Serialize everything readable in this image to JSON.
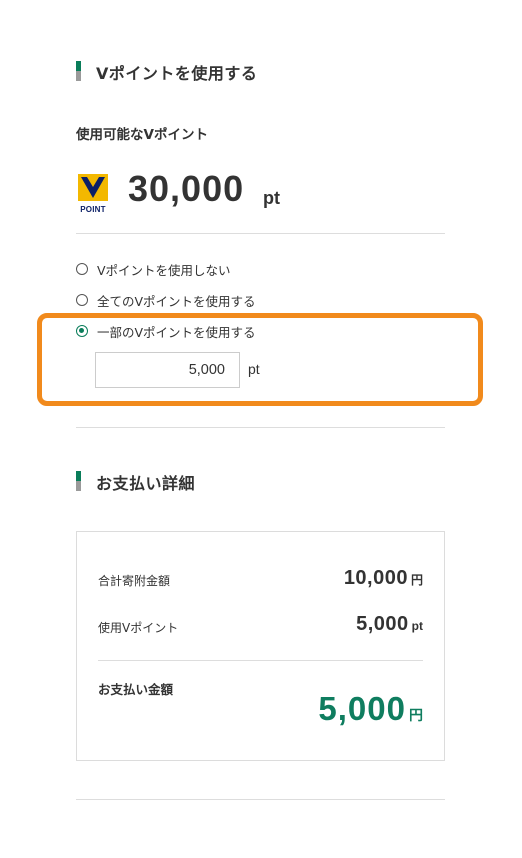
{
  "vpoint_section": {
    "title": "Vポイントを使用する",
    "available_label": "使用可能なVポイント",
    "logo_text": "POINT",
    "balance": "30,000",
    "balance_unit": "pt",
    "options": [
      {
        "label": "Vポイントを使用しない",
        "checked": false
      },
      {
        "label": "全てのVポイントを使用する",
        "checked": false
      },
      {
        "label": "一部のVポイントを使用する",
        "checked": true
      }
    ],
    "partial_input_value": "5,000",
    "partial_input_unit": "pt"
  },
  "payment_section": {
    "title": "お支払い詳細",
    "rows": [
      {
        "label": "合計寄附金額",
        "value": "10,000",
        "unit": "円"
      },
      {
        "label": "使用Vポイント",
        "value": "5,000",
        "unit": "pt"
      }
    ],
    "total_label": "お支払い金額",
    "total_value": "5,000",
    "total_unit": "円"
  },
  "colors": {
    "accent_green": "#0a7d5a",
    "highlight_orange": "#f18a1c",
    "logo_yellow": "#f3b800",
    "logo_navy": "#0b1f66"
  }
}
